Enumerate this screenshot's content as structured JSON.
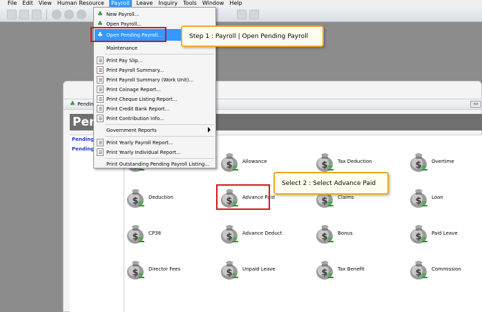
{
  "menubar": {
    "items": [
      "File",
      "Edit",
      "View",
      "Human Resource",
      "Payroll",
      "Leave",
      "Inquiry",
      "Tools",
      "Window",
      "Help"
    ],
    "active": "Payroll"
  },
  "payroll_menu": {
    "items": [
      {
        "label": "New Payroll...",
        "icon": "new-payroll-icon"
      },
      {
        "label": "Open Payroll...",
        "icon": "open-payroll-icon"
      },
      {
        "label": "Open Pending Payroll...",
        "icon": "open-pending-payroll-icon"
      },
      {
        "label": "Maintenance",
        "icon": ""
      },
      {
        "label": "Print Pay Slip...",
        "icon": "document-icon"
      },
      {
        "label": "Print Payroll Summary...",
        "icon": "document-icon"
      },
      {
        "label": "Print Payroll Summary (Work Unit)...",
        "icon": "document-icon"
      },
      {
        "label": "Print Coinage Report...",
        "icon": "document-icon"
      },
      {
        "label": "Print Cheque Listing Report...",
        "icon": "document-icon"
      },
      {
        "label": "Print Credit Bank Report...",
        "icon": "document-icon"
      },
      {
        "label": "Print Contribution Info...",
        "icon": "document-icon"
      },
      {
        "label": "Government Reports",
        "icon": ""
      },
      {
        "label": "Print Yearly Payroll Report...",
        "icon": "document-icon"
      },
      {
        "label": "Print Yearly Individual Report...",
        "icon": "document-icon"
      },
      {
        "label": "Print Outstanding Pending Payroll Listing...",
        "icon": ""
      }
    ]
  },
  "callouts": {
    "step1": "Step 1 : Payroll  | Open Pending Payroll",
    "step2": "Select 2 : Select Advance Paid"
  },
  "window": {
    "title": "Pending",
    "header": "Pen",
    "sidebar_links": [
      "Pending",
      "Pending"
    ]
  },
  "grid_items": [
    "Allowance",
    "Tax Deduction",
    "Overtime",
    "Deduction",
    "Advance Paid",
    "Claims",
    "Loan",
    "CP38",
    "Advance Deduct",
    "Bonus",
    "Paid Leave",
    "Director Fees",
    "Unpaid Leave",
    "Tax Benefit",
    "Commission"
  ],
  "colors": {
    "highlight": "#3399ff",
    "red_box": "#d21616",
    "callout_border": "#f0a81d",
    "link": "#1a34d6"
  }
}
